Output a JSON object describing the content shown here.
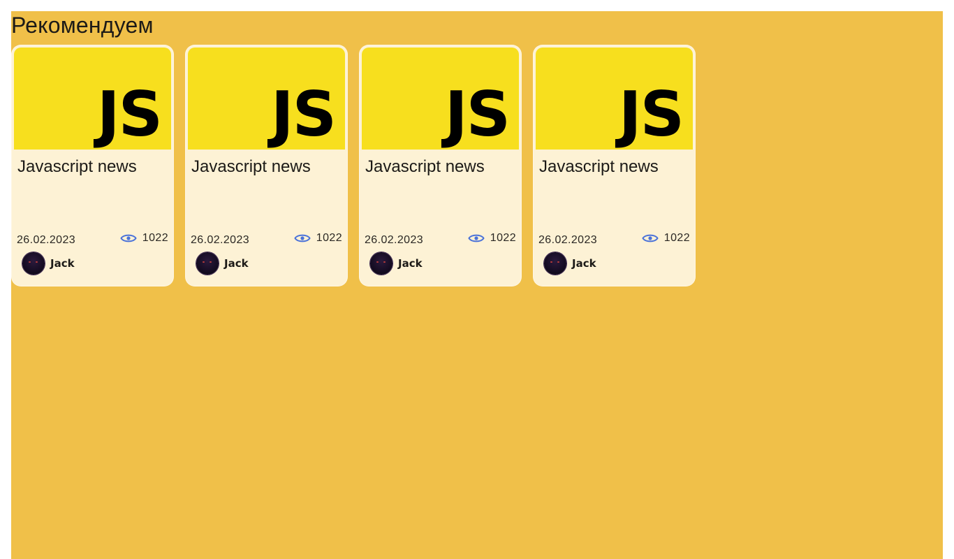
{
  "section": {
    "title": "Рекомендуем"
  },
  "colors": {
    "page_background": "#f0c049",
    "card_background": "#fdf2d5",
    "image_background": "#f7df1e",
    "eye_icon": "#4a72d9"
  },
  "cards": [
    {
      "image_text": "JS",
      "title": "Javascript news",
      "date": "26.02.2023",
      "views": "1022",
      "views_icon": "eye-icon",
      "author": "Jack"
    },
    {
      "image_text": "JS",
      "title": "Javascript news",
      "date": "26.02.2023",
      "views": "1022",
      "views_icon": "eye-icon",
      "author": "Jack"
    },
    {
      "image_text": "JS",
      "title": "Javascript news",
      "date": "26.02.2023",
      "views": "1022",
      "views_icon": "eye-icon",
      "author": "Jack"
    },
    {
      "image_text": "JS",
      "title": "Javascript news",
      "date": "26.02.2023",
      "views": "1022",
      "views_icon": "eye-icon",
      "author": "Jack"
    }
  ]
}
